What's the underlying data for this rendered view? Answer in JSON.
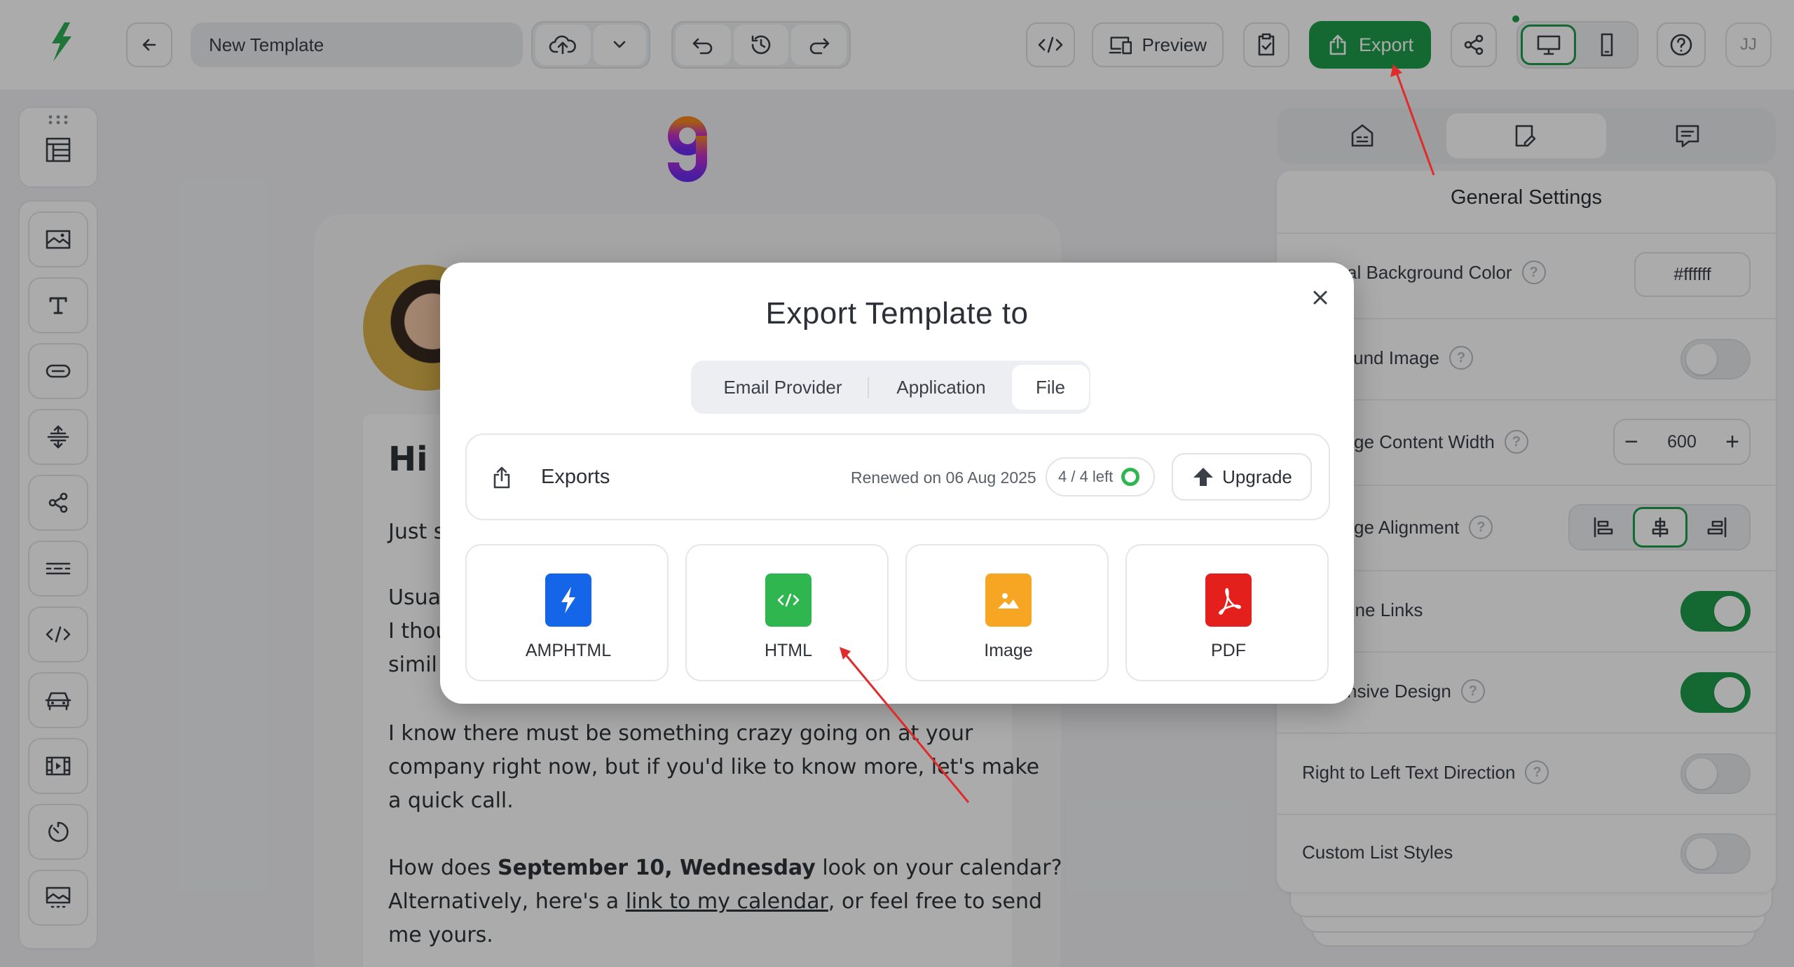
{
  "app": {
    "template_name": "New Template",
    "preview_label": "Preview",
    "export_label": "Export",
    "user_initials": "JJ"
  },
  "canvas": {
    "greeting": "Hi E",
    "line_just": "Just s",
    "line_usual": "Usua",
    "line_thou": "I thou",
    "line_simil": "simil",
    "para2_line1": "I know there must be something crazy going on at your",
    "para2_line2": "company right now, but if you'd like to know more, let's make",
    "para2_line3": "a quick call.",
    "para3_pre": "How does ",
    "para3_bold": "September 10, Wednesday",
    "para3_post": " look on your calendar?",
    "para3_line2_pre": "Alternatively, here's a ",
    "para3_link": "link to my calendar",
    "para3_line2_post": ", or feel free to send",
    "para3_line3": "me yours."
  },
  "settings": {
    "title": "General Settings",
    "bg_color_label": "al Background Color",
    "bg_color_value": "#ffffff",
    "bg_image_label": "round Image",
    "content_width_label": "ge Content Width",
    "content_width_value": "600",
    "alignment_label": "ge Alignment",
    "underline_links_label": "line Links",
    "responsive_label": "nsive Design",
    "rtl_label": "Right to Left Text Direction",
    "list_styles_label": "Custom List Styles",
    "toggles": {
      "background_image": false,
      "underline_links": true,
      "responsive_design": true,
      "rtl": false,
      "custom_list_styles": false
    }
  },
  "modal": {
    "title": "Export Template to",
    "tabs": [
      "Email Provider",
      "Application",
      "File"
    ],
    "active_tab": "File",
    "exports_label": "Exports",
    "renewed_text": "Renewed on 06 Aug 2025",
    "quota_text": "4 / 4 left",
    "upgrade_label": "Upgrade",
    "options": [
      {
        "label": "AMPHTML",
        "color": "#1565e8",
        "icon": "lightning-icon"
      },
      {
        "label": "HTML",
        "color": "#2fb64f",
        "icon": "code-icon"
      },
      {
        "label": "Image",
        "color": "#f6a623",
        "icon": "image-icon"
      },
      {
        "label": "PDF",
        "color": "#e3201b",
        "icon": "pdf-icon"
      }
    ]
  },
  "colors": {
    "brand_green": "#1f9d4b",
    "annotation_red": "#e02b2b"
  }
}
